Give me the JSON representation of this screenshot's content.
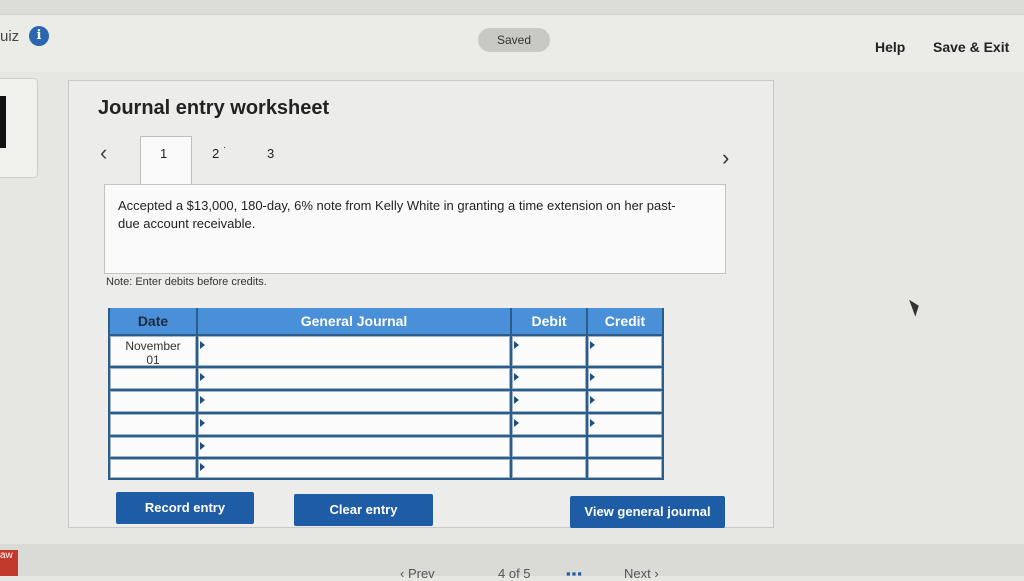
{
  "header": {
    "quiz_label": "uiz",
    "info_icon": "info-icon",
    "saved_status": "Saved",
    "help_label": "Help",
    "save_exit_label": "Save & Exit"
  },
  "worksheet": {
    "title": "Journal entry worksheet",
    "prev_icon": "chevron-left-icon",
    "next_icon": "chevron-right-icon",
    "tabs": [
      "1",
      "2",
      "3"
    ],
    "tab2_marker": "·",
    "active_tab": "1",
    "description": "Accepted a $13,000, 180-day, 6% note from Kelly White in granting a time extension on her past-due account receivable.",
    "note": "Note: Enter debits before credits."
  },
  "table": {
    "headers": {
      "date": "Date",
      "journal": "General Journal",
      "debit": "Debit",
      "credit": "Credit"
    },
    "rows": [
      {
        "date_line1": "November",
        "date_line2": "01",
        "account": "",
        "debit": "",
        "credit": ""
      },
      {
        "date_line1": "",
        "date_line2": "",
        "account": "",
        "debit": "",
        "credit": ""
      },
      {
        "date_line1": "",
        "date_line2": "",
        "account": "",
        "debit": "",
        "credit": ""
      },
      {
        "date_line1": "",
        "date_line2": "",
        "account": "",
        "debit": "",
        "credit": ""
      },
      {
        "date_line1": "",
        "date_line2": "",
        "account": "",
        "debit": "",
        "credit": ""
      },
      {
        "date_line1": "",
        "date_line2": "",
        "account": "",
        "debit": "",
        "credit": ""
      }
    ]
  },
  "buttons": {
    "record": "Record entry",
    "clear": "Clear entry",
    "view": "View general journal"
  },
  "footer": {
    "badge": "aw",
    "prev": "Prev",
    "page": "4 of 5",
    "next": "Next"
  },
  "colors": {
    "accent": "#1f5ca6",
    "table_header": "#4a90d9",
    "info": "#2a65b0"
  }
}
